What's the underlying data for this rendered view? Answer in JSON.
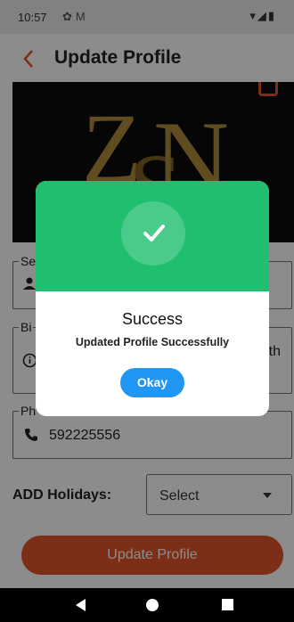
{
  "status_bar": {
    "time": "10:57",
    "icons": [
      "settings-icon",
      "gmail-icon",
      "wifi-icon",
      "signal-icon",
      "battery-icon"
    ]
  },
  "app_bar": {
    "back_icon": "chevron-left-icon",
    "title": "Update Profile",
    "accent_color": "#e2542b"
  },
  "banner": {
    "logo_text": "ZSN",
    "camera_icon": "camera-icon"
  },
  "form": {
    "service_label": "Se",
    "bio_label": "Bi",
    "bio_value_partial": "th",
    "phone_label": "Ph",
    "phone_value": "592225556",
    "holidays_label": "ADD Holidays:",
    "holidays_select_value": "Select",
    "update_button": "Update Profile"
  },
  "dialog": {
    "title": "Success",
    "message": "Updated Profile Successfully",
    "button_label": "Okay",
    "header_color": "#1fbf6f",
    "button_color": "#2196f3"
  }
}
